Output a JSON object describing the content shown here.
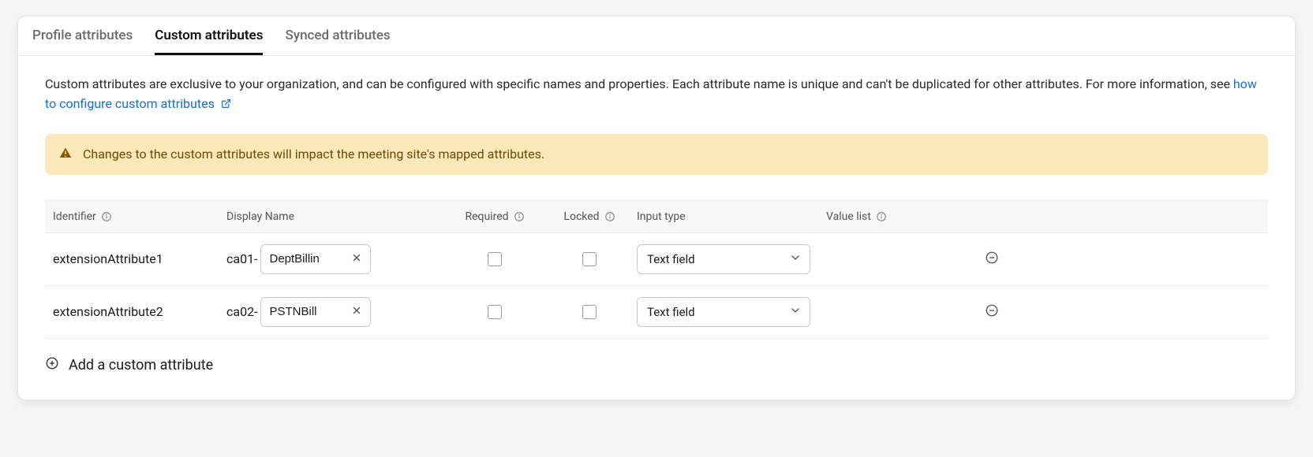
{
  "tabs": [
    {
      "label": "Profile attributes",
      "active": false
    },
    {
      "label": "Custom attributes",
      "active": true
    },
    {
      "label": "Synced attributes",
      "active": false
    }
  ],
  "intro": {
    "text_before_link": "Custom attributes are exclusive to your organization, and can be configured with specific names and properties. Each attribute name is unique and can't be duplicated for other attributes. For more information, see ",
    "link_text": "how to configure custom attributes"
  },
  "alert": {
    "text": "Changes to the custom attributes will impact the meeting site's mapped attributes."
  },
  "columns": {
    "identifier": "Identifier",
    "display_name": "Display Name",
    "required": "Required",
    "locked": "Locked",
    "input_type": "Input type",
    "value_list": "Value list"
  },
  "rows": [
    {
      "identifier": "extensionAttribute1",
      "prefix": "ca01-",
      "name": "DeptBillin",
      "required": false,
      "locked": false,
      "input_type": "Text field"
    },
    {
      "identifier": "extensionAttribute2",
      "prefix": "ca02-",
      "name": "PSTNBill",
      "required": false,
      "locked": false,
      "input_type": "Text field"
    }
  ],
  "add_button": "Add a custom attribute"
}
